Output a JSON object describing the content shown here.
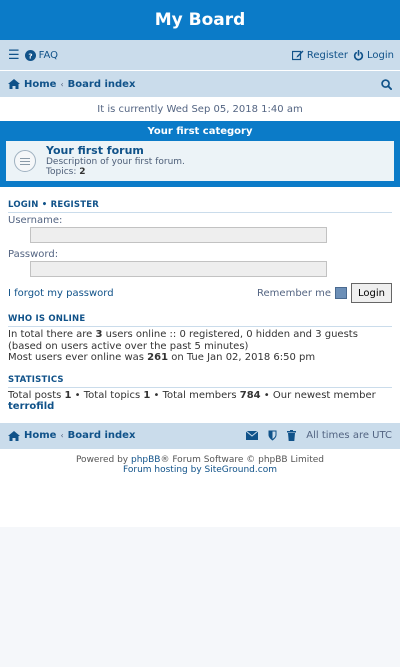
{
  "header": {
    "title": "My Board"
  },
  "navbar": {
    "faq_label": "FAQ",
    "register_label": "Register",
    "login_label": "Login"
  },
  "breadcrumb": {
    "home": "Home",
    "separator": "‹",
    "board_index": "Board index"
  },
  "current_time": "It is currently Wed Sep 05, 2018 1:40 am",
  "category": {
    "title": "Your first category",
    "forums": [
      {
        "title": "Your first forum",
        "description": "Description of your first forum.",
        "topics_label": "Topics:",
        "topics_count": "2"
      }
    ]
  },
  "login": {
    "heading": "LOGIN",
    "heading_separator": "•",
    "register_heading": "REGISTER",
    "username_label": "Username:",
    "username_value": "",
    "password_label": "Password:",
    "password_value": "",
    "forgot_link": "I forgot my password",
    "remember_label": "Remember me",
    "remember_checked": false,
    "login_button": "Login"
  },
  "who_is_online": {
    "heading": "WHO IS ONLINE",
    "line1_pre": "In total there are ",
    "users_count": "3",
    "line1_post": " users online :: 0 registered, 0 hidden and 3 guests",
    "line2": "(based on users active over the past 5 minutes)",
    "line3_pre": "Most users ever online was ",
    "max_users": "261",
    "line3_post": " on Tue Jan 02, 2018 6:50 pm"
  },
  "statistics": {
    "heading": "STATISTICS",
    "posts_label": "Total posts ",
    "posts": "1",
    "topics_label": " • Total topics ",
    "topics": "1",
    "members_label": " • Total members ",
    "members": "784",
    "newest_label": " • Our newest member ",
    "newest_member": "terrofild"
  },
  "footer_nav": {
    "home": "Home",
    "separator": "‹",
    "board_index": "Board index",
    "timezone": "All times are UTC"
  },
  "copyright": {
    "powered_pre": "Powered by ",
    "phpbb_link": "phpBB",
    "powered_post": "® Forum Software © phpBB Limited",
    "hosting_pre": "Forum hosting by ",
    "hosting_link": "SiteGround.com"
  },
  "colors": {
    "brand": "#0b7bc8",
    "nav_bg": "#cadceb",
    "link": "#105289"
  },
  "icons": [
    "hamburger-icon",
    "faq-icon",
    "register-icon",
    "power-icon",
    "home-icon",
    "search-icon",
    "forum-read-icon",
    "envelope-icon",
    "shield-icon",
    "trash-icon"
  ]
}
